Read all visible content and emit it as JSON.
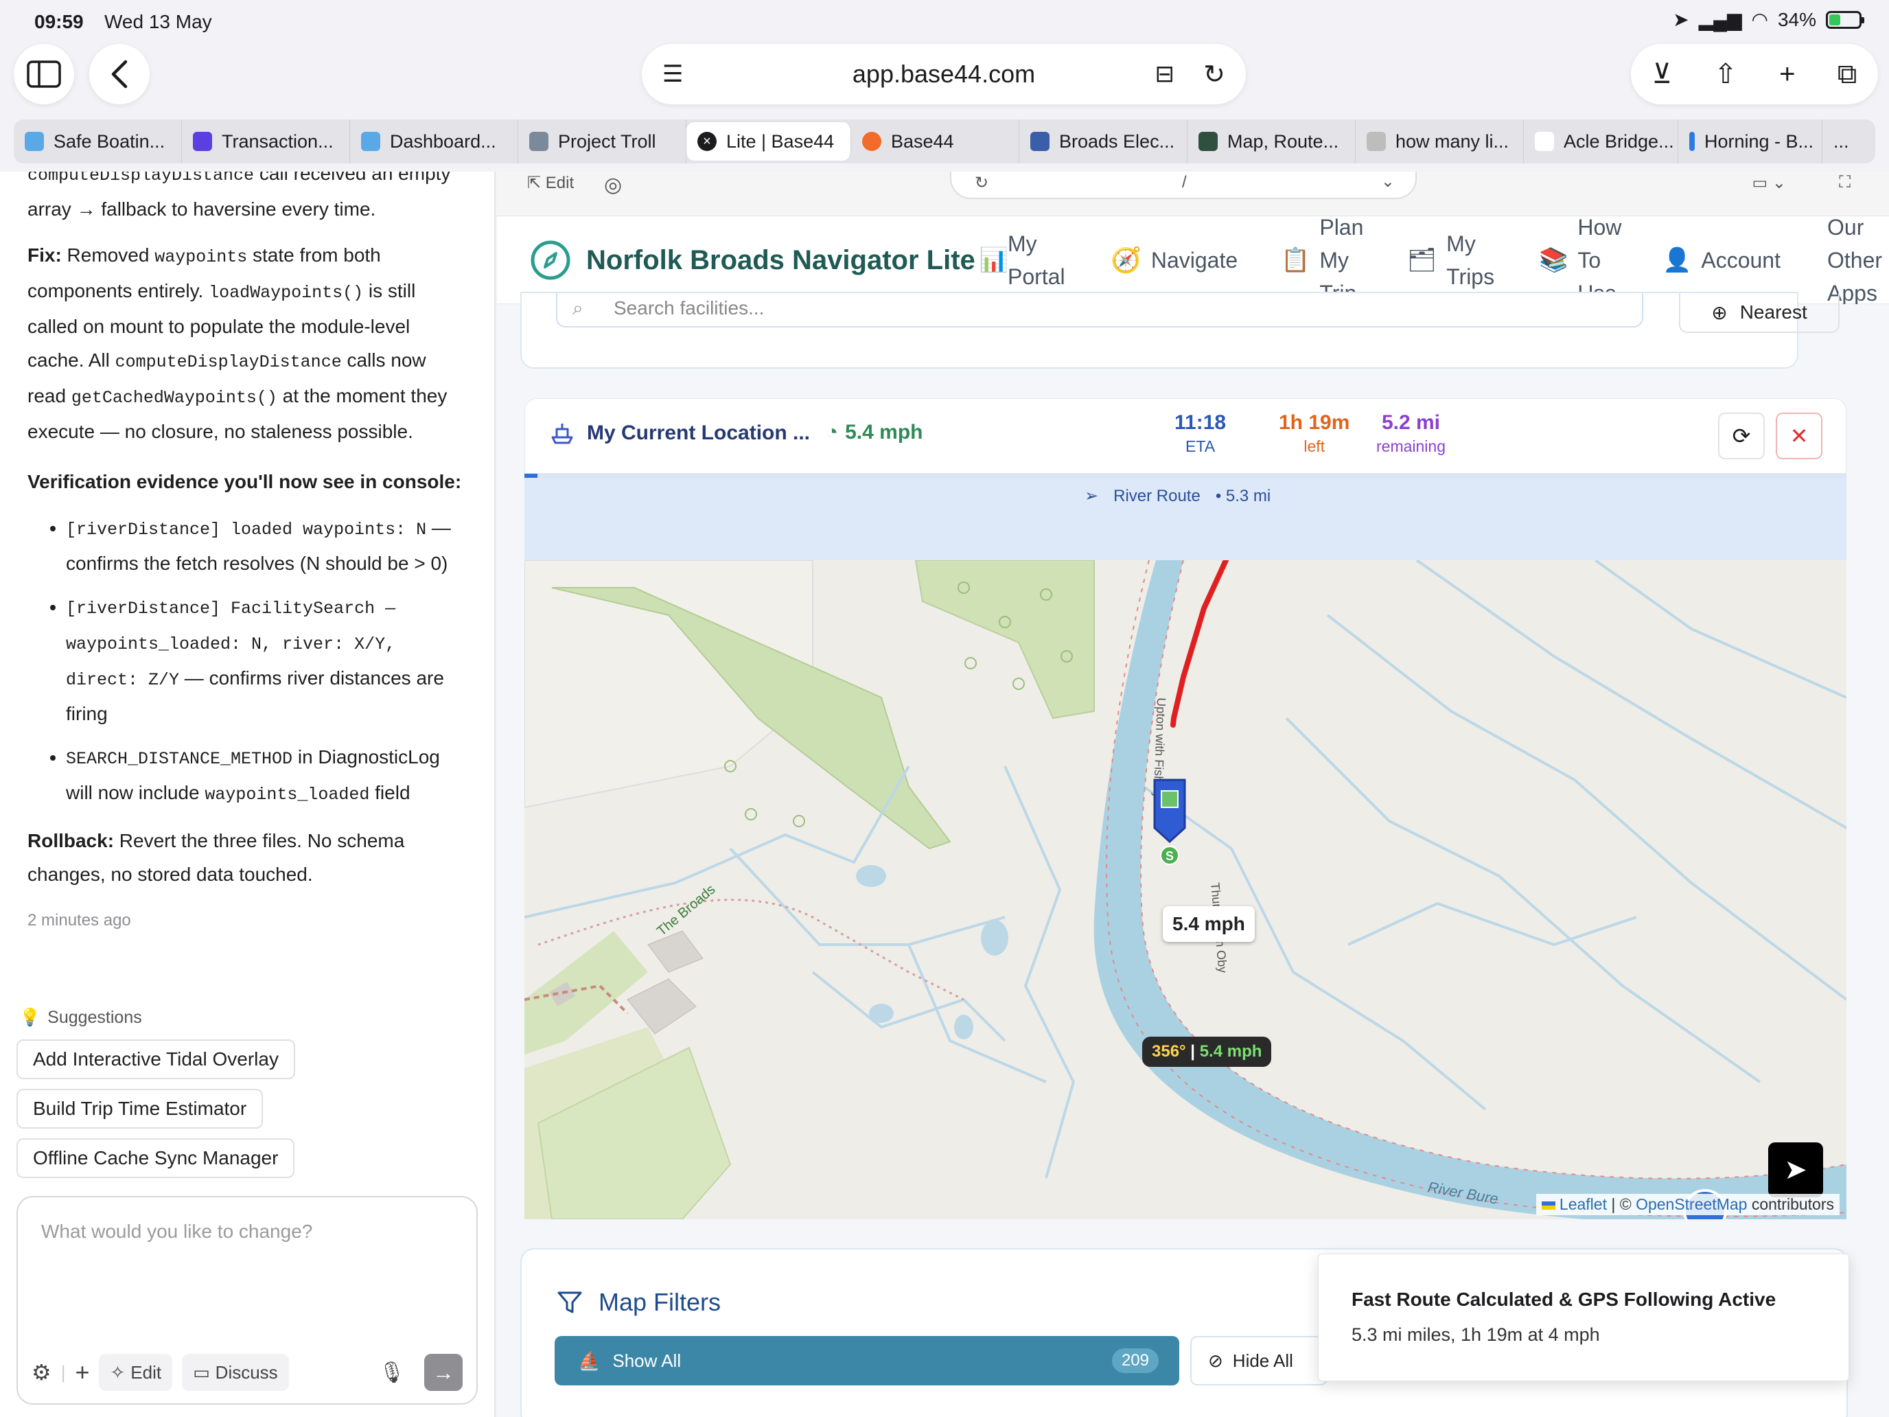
{
  "status": {
    "time": "09:59",
    "date": "Wed 13 May",
    "battery": "34%"
  },
  "browser": {
    "url": "app.base44.com",
    "tabs": [
      {
        "label": "Safe Boatin...",
        "color": "#5aa9e6"
      },
      {
        "label": "Transaction...",
        "color": "#5b3fe0"
      },
      {
        "label": "Dashboard...",
        "color": "#5aa9e6"
      },
      {
        "label": "Project Troll",
        "color": "#7a8a9a"
      },
      {
        "label": "Lite | Base44",
        "color": "#1c1c1e"
      },
      {
        "label": "Base44",
        "color": "#f26b2a"
      },
      {
        "label": "Broads Elec...",
        "color": "#3b5ea8"
      },
      {
        "label": "Map, Route...",
        "color": "#2f4f3f"
      },
      {
        "label": "how many li...",
        "color": "#bdbdbd"
      },
      {
        "label": "Acle Bridge...",
        "color": "#ffffff"
      },
      {
        "label": "Horning - B...",
        "color": "#2b7be0"
      },
      {
        "label": "...",
        "color": "#ffffff"
      }
    ]
  },
  "chat": {
    "line0_code": "computeDisplayDistance",
    "line0_rest": " call received an empty",
    "line1": "array → fallback to haversine every time.",
    "fix_label": "Fix:",
    "fix_t1": " Removed ",
    "fix_c1": "waypoints",
    "fix_t2": " state from both components entirely. ",
    "fix_c2": "loadWaypoints()",
    "fix_t3": " is still called on mount to populate the module-level cache. All ",
    "fix_c3": "computeDisplayDistance",
    "fix_t4": " calls now read ",
    "fix_c4": "getCachedWaypoints()",
    "fix_t5": " at the moment they execute — no closure, no staleness possible.",
    "verify_heading": "Verification evidence you'll now see in console:",
    "b1_code": "[riverDistance] loaded waypoints: N",
    "b1_text": " — confirms the fetch resolves (N should be > 0)",
    "b2_code": "[riverDistance] FacilitySearch — waypoints_loaded: N, river: X/Y, direct: Z/Y",
    "b2_text": " — confirms river distances are firing",
    "b3_code1": "SEARCH_DISTANCE_METHOD",
    "b3_t1": " in DiagnosticLog will now include ",
    "b3_code2": "waypoints_loaded",
    "b3_t2": " field",
    "rollback_label": "Rollback:",
    "rollback_text": " Revert the three files. No schema changes, no stored data touched.",
    "time_ago": "2 minutes ago"
  },
  "suggestions": {
    "heading": "Suggestions",
    "items": [
      "Add Interactive Tidal Overlay",
      "Build Trip Time Estimator",
      "Offline Cache Sync Manager"
    ]
  },
  "composer": {
    "placeholder": "What would you like to change?",
    "edit": "Edit",
    "discuss": "Discuss"
  },
  "app": {
    "stripe_edit": "Edit",
    "stripe_path": "/",
    "brand": "Norfolk Broads Navigator Lite",
    "nav": {
      "portal": "My Portal",
      "navigate": "Navigate",
      "plan": "Plan My Trip",
      "trips": "My Trips",
      "howto": "How To Use",
      "account": "Account",
      "other": "Our Other Apps"
    },
    "search_placeholder": "Search facilities...",
    "nearest": "Nearest"
  },
  "trip": {
    "location": "My Current Location ...",
    "speed": "5.4 mph",
    "eta_value": "11:18",
    "eta_label": "ETA",
    "left_value": "1h 19m",
    "left_label": "left",
    "remaining_value": "5.2 mi",
    "remaining_label": "remaining",
    "progress_fraction": 0.01,
    "route_label": "River Route",
    "route_distance": "• 5.3 mi",
    "colors": {
      "eta": "#2b57b5",
      "left": "#e0651a",
      "remaining": "#8b3fd1"
    }
  },
  "map": {
    "speed_tag": "5.4 mph",
    "heading": "356°",
    "heading_speed": "5.4 mph",
    "separator": " | ",
    "label_broads": "The Broads",
    "label_river": "River Bure",
    "label_upton": "Upton with Fishley",
    "label_oby": "Thurne with Oby",
    "marker_badge": "S",
    "attribution_leaflet": "Leaflet",
    "attribution_sep": " | © ",
    "attribution_osm": "OpenStreetMap",
    "attribution_tail": " contributors"
  },
  "filters": {
    "title": "Map Filters",
    "show_all": "Show All",
    "show_all_count": "209",
    "hide_all": "Hide All"
  },
  "toast": {
    "title": "Fast Route Calculated & GPS Following Active",
    "desc": "5.3 mi miles, 1h 19m at 4 mph"
  }
}
